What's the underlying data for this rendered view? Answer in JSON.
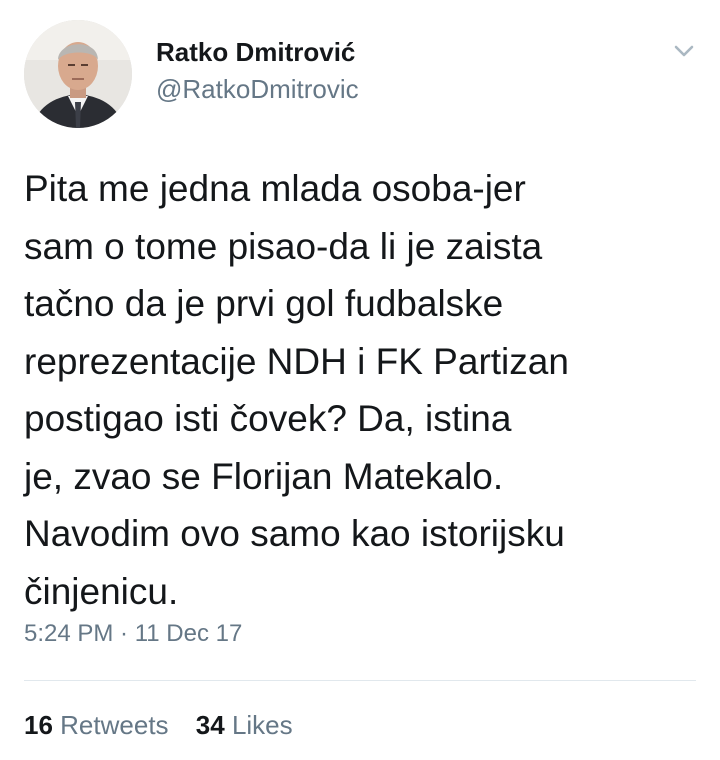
{
  "author": {
    "display_name": "Ratko Dmitrović",
    "handle": "@RatkoDmitrovic"
  },
  "tweet": {
    "lines": [
      "Pita me jedna mlada osoba-jer",
      "sam o tome pisao-da li je zaista",
      "tačno da je prvi gol fudbalske",
      "reprezentacije NDH i FK Partizan",
      "postigao isti čovek? Da, istina",
      "je, zvao se Florijan Matekalo.",
      "Navodim ovo samo kao istorijsku",
      "činjenicu."
    ],
    "timestamp": "5:24 PM · 11 Dec 17"
  },
  "stats": {
    "retweets_count": "16",
    "retweets_label": "Retweets",
    "likes_count": "34",
    "likes_label": "Likes"
  },
  "icons": {
    "menu": "chevron-down-icon"
  },
  "colors": {
    "text_primary": "#14171a",
    "text_secondary": "#657786",
    "divider": "#e1e8ed"
  }
}
